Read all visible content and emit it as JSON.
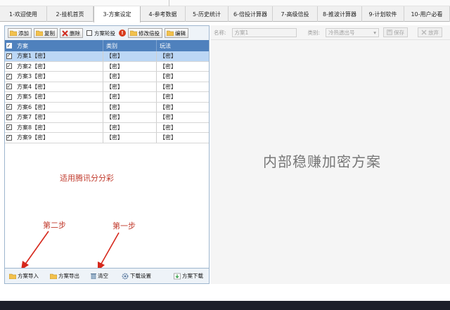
{
  "tabs": [
    {
      "label": "1-欢迎使用",
      "width": 67
    },
    {
      "label": "2-挂机首页",
      "width": 66
    },
    {
      "label": "3-方案设定",
      "width": 67,
      "active": true
    },
    {
      "label": "4-参考数据",
      "width": 64
    },
    {
      "label": "5-历史统计",
      "width": 61
    },
    {
      "label": "6-倍投计算器",
      "width": 63
    },
    {
      "label": "7-高级倍投",
      "width": 64
    },
    {
      "label": "8-推波计算器",
      "width": 63
    },
    {
      "label": "9-计划软件",
      "width": 60
    },
    {
      "label": "10-用户必看",
      "width": 65
    }
  ],
  "toolbar": {
    "add": "添加",
    "copy": "复制",
    "delete": "删除",
    "rotate": "方案轮投",
    "modify_multiplier": "修改倍投",
    "edit": "编辑"
  },
  "grid": {
    "headers": [
      "方案",
      "类别",
      "玩法"
    ],
    "rows": [
      {
        "name": "方案1【密】",
        "category": "【密】",
        "play": "【密】",
        "checked": true,
        "selected": true
      },
      {
        "name": "方案2【密】",
        "category": "【密】",
        "play": "【密】",
        "checked": true
      },
      {
        "name": "方案3【密】",
        "category": "【密】",
        "play": "【密】",
        "checked": true
      },
      {
        "name": "方案4【密】",
        "category": "【密】",
        "play": "【密】",
        "checked": true
      },
      {
        "name": "方案5【密】",
        "category": "【密】",
        "play": "【密】",
        "checked": true
      },
      {
        "name": "方案6【密】",
        "category": "【密】",
        "play": "【密】",
        "checked": true
      },
      {
        "name": "方案7【密】",
        "category": "【密】",
        "play": "【密】",
        "checked": true
      },
      {
        "name": "方案8【密】",
        "category": "【密】",
        "play": "【密】",
        "checked": true
      },
      {
        "name": "方案9【密】",
        "category": "【密】",
        "play": "【密】",
        "checked": true
      }
    ]
  },
  "annotations": {
    "note": "适用腾讯分分彩",
    "step2": "第二步",
    "step1": "第一步"
  },
  "bottom": {
    "import": "方案导入",
    "export": "方案导出",
    "clear": "清空",
    "download_settings": "下载设置",
    "download": "方案下载"
  },
  "right": {
    "name_label": "名称:",
    "name_value": "方案1",
    "category_label": "类别:",
    "category_value": "冷热遗出号",
    "save": "保存",
    "discard": "放弃",
    "watermark": "内部稳赚加密方案"
  },
  "colors": {
    "header_blue": "#4f81bd",
    "selected_row": "#bcd7f5",
    "annotation_red": "#c0392b"
  }
}
